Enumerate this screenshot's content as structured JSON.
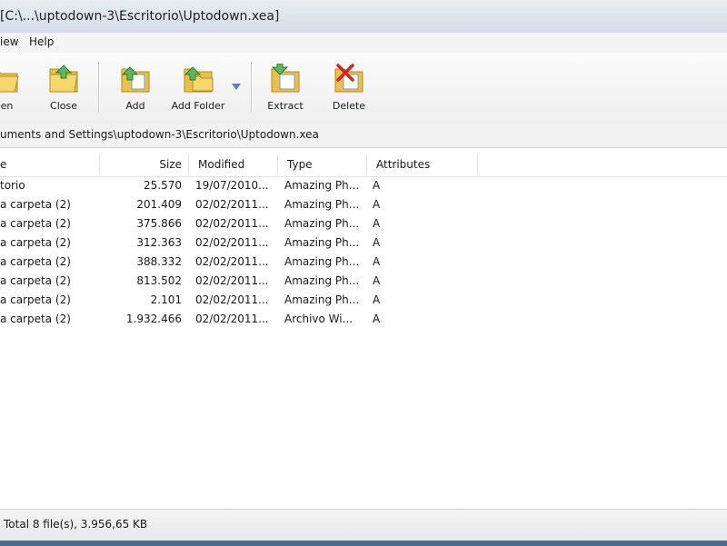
{
  "window": {
    "title": "[C:\\...\\uptodown-3\\Escritorio\\Uptodown.xea]"
  },
  "menu": {
    "items": [
      "iew",
      "Help"
    ]
  },
  "toolbar": {
    "buttons": [
      {
        "label": "pen",
        "icon": "open-folder-icon"
      },
      {
        "label": "Close",
        "icon": "close-folder-icon"
      },
      {
        "label": "Add",
        "icon": "add-icon"
      },
      {
        "label": "Add Folder",
        "icon": "add-folder-icon"
      },
      {
        "label": "Extract",
        "icon": "extract-icon"
      },
      {
        "label": "Delete",
        "icon": "delete-icon"
      }
    ]
  },
  "path": "uments and Settings\\uptodown-3\\Escritorio\\Uptodown.xea",
  "table": {
    "columns": [
      "e",
      "Size",
      "Modified",
      "Type",
      "Attributes"
    ],
    "rows": [
      [
        "torio",
        "25.570",
        "19/07/2010...",
        "Amazing Ph...",
        "A"
      ],
      [
        "a carpeta (2)",
        "201.409",
        "02/02/2011...",
        "Amazing Ph...",
        "A"
      ],
      [
        "a carpeta (2)",
        "375.866",
        "02/02/2011...",
        "Amazing Ph...",
        "A"
      ],
      [
        "a carpeta (2)",
        "312.363",
        "02/02/2011...",
        "Amazing Ph...",
        "A"
      ],
      [
        "a carpeta (2)",
        "388.332",
        "02/02/2011...",
        "Amazing Ph...",
        "A"
      ],
      [
        "a carpeta (2)",
        "813.502",
        "02/02/2011...",
        "Amazing Ph...",
        "A"
      ],
      [
        "a carpeta (2)",
        "2.101",
        "02/02/2011...",
        "Amazing Ph...",
        "A"
      ],
      [
        "a carpeta (2)",
        "1.932.466",
        "02/02/2011...",
        "Archivo Wi...",
        "A"
      ]
    ]
  },
  "status": "Total 8 file(s), 3.956,65 KB"
}
